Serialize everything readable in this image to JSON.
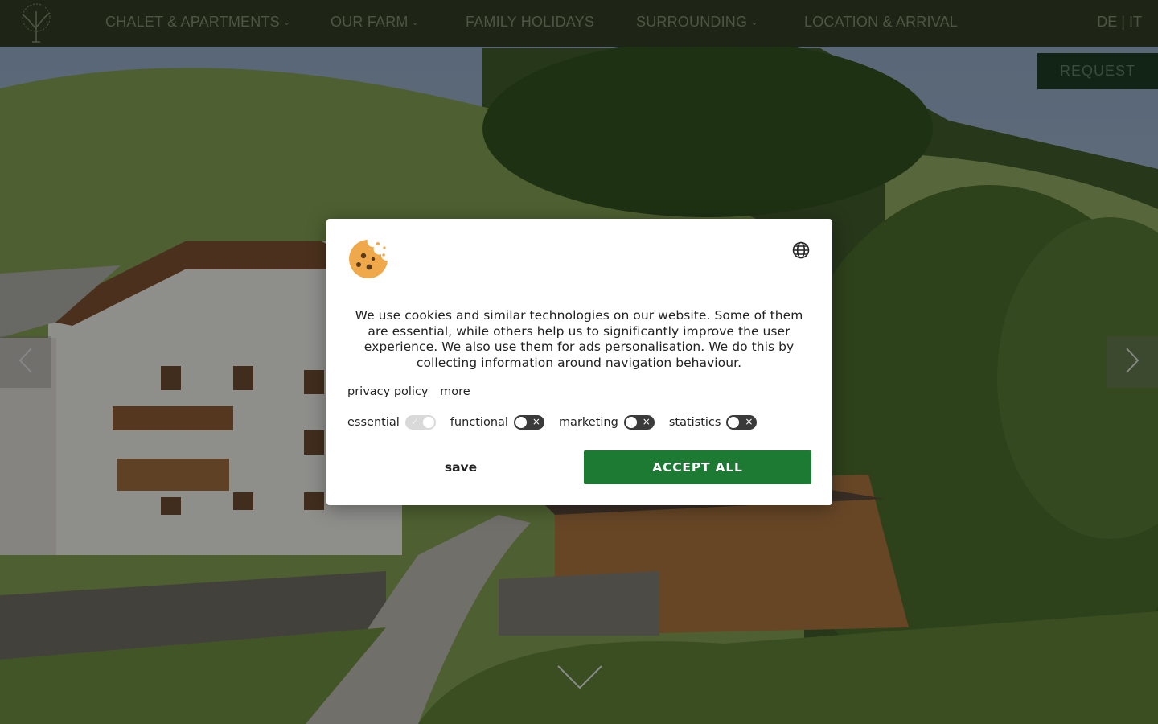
{
  "nav": {
    "items": [
      {
        "label": "CHALET & APARTMENTS",
        "has_dropdown": true
      },
      {
        "label": "OUR FARM",
        "has_dropdown": true
      },
      {
        "label": "FAMILY HOLIDAYS",
        "has_dropdown": false
      },
      {
        "label": "SURROUNDING",
        "has_dropdown": true
      },
      {
        "label": "LOCATION & ARRIVAL",
        "has_dropdown": false
      }
    ],
    "lang_de": "DE",
    "lang_sep": "|",
    "lang_it": "IT",
    "dropdown_glyph": "⌄"
  },
  "request_label": "REQUEST",
  "icons": {
    "logo": "tree-logo-icon",
    "slider_prev": "chevron-left-icon",
    "slider_next": "chevron-right-icon",
    "scroll": "chevron-down-icon",
    "cookie": "cookie-icon",
    "language": "globe-icon"
  },
  "cookie_dialog": {
    "text": "We use cookies and similar technologies on our website. Some of them are essential, while others help us to significantly improve the user experience. We also use them for ads personalisation. We do this by collecting information around navigation behaviour.",
    "privacy_link": "privacy policy",
    "more_link": "more",
    "toggles": [
      {
        "label": "essential",
        "enabled": true,
        "locked": true
      },
      {
        "label": "functional",
        "enabled": false,
        "locked": false
      },
      {
        "label": "marketing",
        "enabled": false,
        "locked": false
      },
      {
        "label": "statistics",
        "enabled": false,
        "locked": false
      }
    ],
    "save_label": "save",
    "accept_label": "ACCEPT ALL"
  },
  "colors": {
    "nav_bg": "#333d24",
    "nav_text": "#7f8a6b",
    "request_bg": "#1d3a24",
    "accept_bg": "#1c7a33"
  }
}
